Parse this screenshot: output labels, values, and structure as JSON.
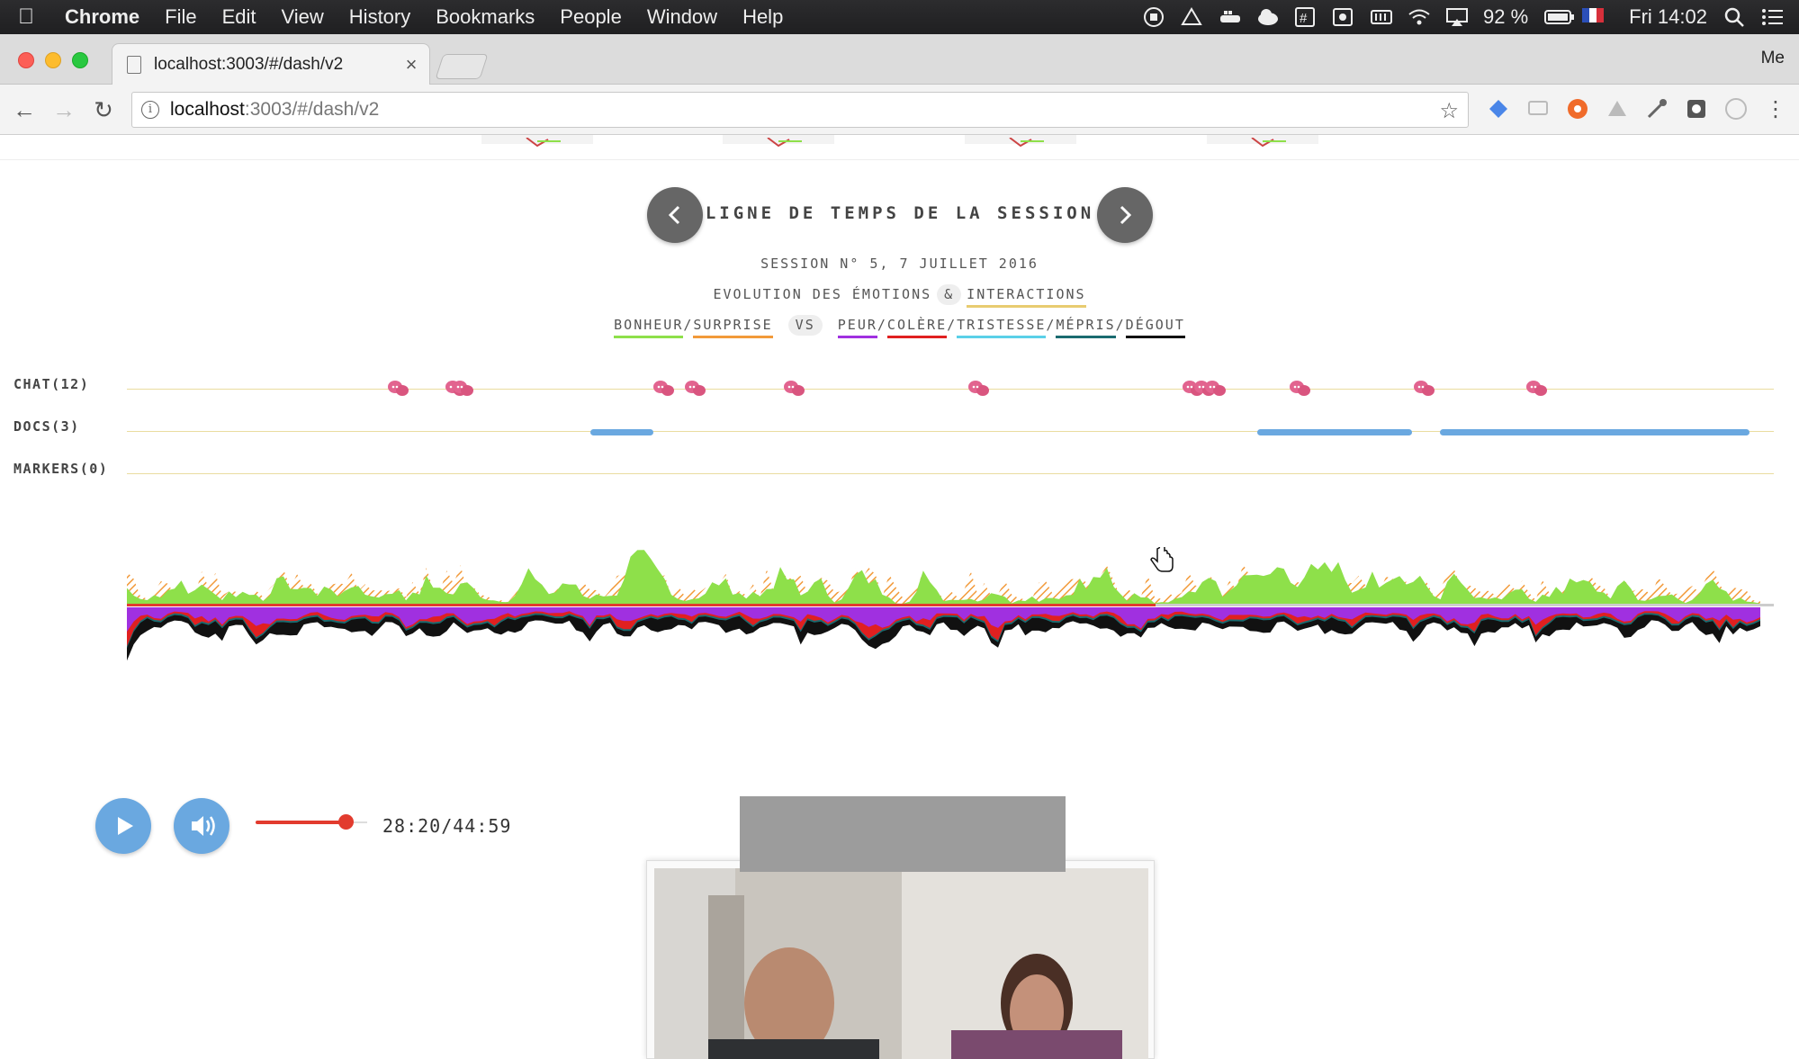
{
  "menubar": {
    "app": "Chrome",
    "items": [
      "File",
      "Edit",
      "View",
      "History",
      "Bookmarks",
      "People",
      "Window",
      "Help"
    ],
    "battery": "92 %",
    "clock": "Fri 14:02"
  },
  "browser": {
    "tab_title": "localhost:3003/#/dash/v2",
    "profile": "Me",
    "url_host": "localhost",
    "url_path": ":3003/#/dash/v2"
  },
  "timeline": {
    "title": "LIGNE DE TEMPS DE LA SESSION",
    "session": "SESSION N° 5, 7 JUILLET 2016",
    "evolution": "EVOLUTION DES ÉMOTIONS",
    "amp": "&",
    "interactions": "INTERACTIONS",
    "positive": [
      "BONHEUR",
      "/",
      "SURPRISE"
    ],
    "vs": "VS",
    "negative": [
      "PEUR",
      "/",
      "COLÈRE",
      "/",
      "TRISTESSE",
      "/",
      "MÉPRIS",
      "/",
      "DÉGOUT"
    ],
    "colors": {
      "bonheur": "#8ee04a",
      "surprise": "#f29a3a",
      "peur": "#a030e0",
      "colere": "#e02020",
      "tristesse": "#5ad0e8",
      "mepris": "#1a6b70",
      "degout": "#111111",
      "interactions": "#e8cc70"
    },
    "rows": [
      {
        "label": "CHAT(12)"
      },
      {
        "label": "DOCS(3)"
      },
      {
        "label": "MARKERS(0)"
      }
    ]
  },
  "player": {
    "time": "28:20/44:59",
    "volume_level": 0.8,
    "progress": 0.63
  }
}
